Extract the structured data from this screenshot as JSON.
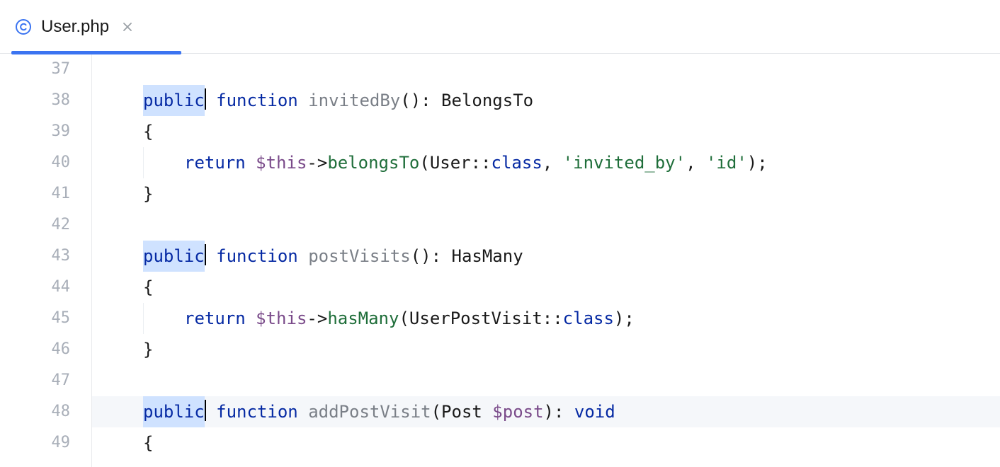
{
  "tab": {
    "file_name": "User.php",
    "close_tooltip": "Close"
  },
  "gutter": {
    "start": 37,
    "end": 49
  },
  "code": {
    "highlighted_word": "public",
    "current_line": 48,
    "lines": {
      "37": {
        "indent": 1,
        "tokens": []
      },
      "38": {
        "indent": 1,
        "tokens": [
          {
            "t": "public",
            "c": "hl-sel",
            "cursor_after": true
          },
          {
            "t": " ",
            "c": "plain"
          },
          {
            "t": "function",
            "c": "kw"
          },
          {
            "t": " ",
            "c": "plain"
          },
          {
            "t": "invitedBy",
            "c": "fn"
          },
          {
            "t": "(): ",
            "c": "punct"
          },
          {
            "t": "BelongsTo",
            "c": "type"
          }
        ]
      },
      "39": {
        "indent": 1,
        "tokens": [
          {
            "t": "{",
            "c": "punct"
          }
        ]
      },
      "40": {
        "indent": 2,
        "tokens": [
          {
            "t": "return",
            "c": "kw"
          },
          {
            "t": " ",
            "c": "plain"
          },
          {
            "t": "$this",
            "c": "var"
          },
          {
            "t": "->",
            "c": "punct"
          },
          {
            "t": "belongsTo",
            "c": "prop"
          },
          {
            "t": "(",
            "c": "punct"
          },
          {
            "t": "User",
            "c": "cls"
          },
          {
            "t": "::",
            "c": "punct"
          },
          {
            "t": "class",
            "c": "konst"
          },
          {
            "t": ", ",
            "c": "punct"
          },
          {
            "t": "'invited_by'",
            "c": "str"
          },
          {
            "t": ", ",
            "c": "punct"
          },
          {
            "t": "'id'",
            "c": "str"
          },
          {
            "t": ");",
            "c": "punct"
          }
        ]
      },
      "41": {
        "indent": 1,
        "tokens": [
          {
            "t": "}",
            "c": "punct"
          }
        ]
      },
      "42": {
        "indent": 0,
        "tokens": []
      },
      "43": {
        "indent": 1,
        "tokens": [
          {
            "t": "public",
            "c": "hl-sel",
            "cursor_after": true
          },
          {
            "t": " ",
            "c": "plain"
          },
          {
            "t": "function",
            "c": "kw"
          },
          {
            "t": " ",
            "c": "plain"
          },
          {
            "t": "postVisits",
            "c": "fn"
          },
          {
            "t": "(): ",
            "c": "punct"
          },
          {
            "t": "HasMany",
            "c": "type"
          }
        ]
      },
      "44": {
        "indent": 1,
        "tokens": [
          {
            "t": "{",
            "c": "punct"
          }
        ]
      },
      "45": {
        "indent": 2,
        "tokens": [
          {
            "t": "return",
            "c": "kw"
          },
          {
            "t": " ",
            "c": "plain"
          },
          {
            "t": "$this",
            "c": "var"
          },
          {
            "t": "->",
            "c": "punct"
          },
          {
            "t": "hasMany",
            "c": "prop"
          },
          {
            "t": "(",
            "c": "punct"
          },
          {
            "t": "UserPostVisit",
            "c": "cls"
          },
          {
            "t": "::",
            "c": "punct"
          },
          {
            "t": "class",
            "c": "konst"
          },
          {
            "t": ");",
            "c": "punct"
          }
        ]
      },
      "46": {
        "indent": 1,
        "tokens": [
          {
            "t": "}",
            "c": "punct"
          }
        ]
      },
      "47": {
        "indent": 0,
        "tokens": []
      },
      "48": {
        "indent": 1,
        "tokens": [
          {
            "t": "public",
            "c": "hl-sel",
            "cursor_after": true
          },
          {
            "t": " ",
            "c": "plain"
          },
          {
            "t": "function",
            "c": "kw"
          },
          {
            "t": " ",
            "c": "plain"
          },
          {
            "t": "addPostVisit",
            "c": "fn"
          },
          {
            "t": "(",
            "c": "punct"
          },
          {
            "t": "Post",
            "c": "type"
          },
          {
            "t": " ",
            "c": "plain"
          },
          {
            "t": "$post",
            "c": "var"
          },
          {
            "t": "): ",
            "c": "punct"
          },
          {
            "t": "void",
            "c": "kw"
          }
        ]
      },
      "49": {
        "indent": 1,
        "tokens": [
          {
            "t": "{",
            "c": "punct"
          }
        ]
      }
    }
  }
}
